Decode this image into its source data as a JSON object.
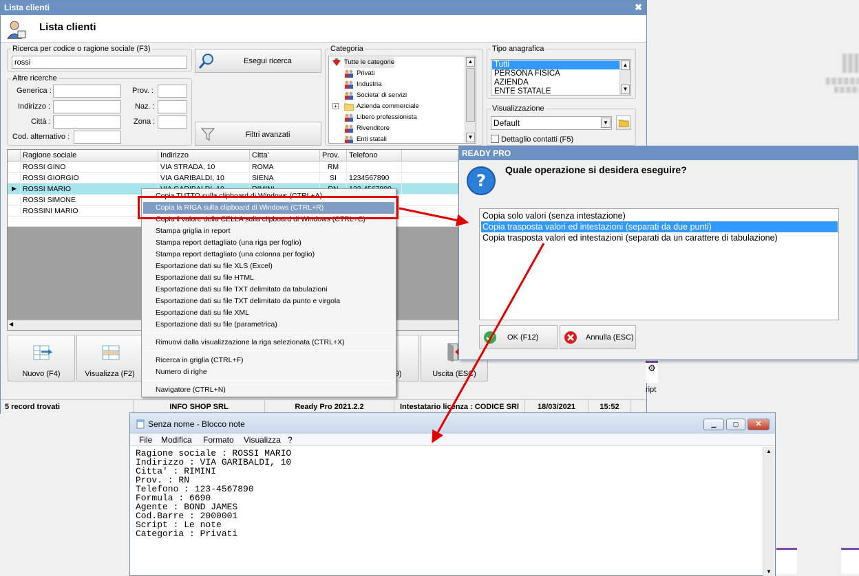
{
  "window": {
    "title": "Lista clienti",
    "header_title": "Lista clienti"
  },
  "search": {
    "group_label": "Ricerca per codice o ragione sociale (F3)",
    "value": "rossi",
    "execute_button": "Esegui ricerca",
    "advanced_filters_button": "Filtri avanzati"
  },
  "other_searches": {
    "group_label": "Altre ricerche",
    "generica_label": "Generica :",
    "indirizzo_label": "Indirizzo :",
    "citta_label": "Città :",
    "cod_alt_label": "Cod. alternativo :",
    "prov_label": "Prov. :",
    "naz_label": "Naz. :",
    "zona_label": "Zona :"
  },
  "categoria": {
    "group_label": "Categoria",
    "items": [
      "Tutte le categorie",
      "Privati",
      "Industria",
      "Societa' di servizi",
      "Azienda commerciale",
      "Libero professionista",
      "Rivenditore",
      "Enti statali"
    ]
  },
  "tipo_anagrafica": {
    "group_label": "Tipo anagrafica",
    "options": [
      "Tutti",
      "PERSONA FISICA",
      "AZIENDA",
      "ENTE STATALE"
    ],
    "selected": "Tutti"
  },
  "visualizzazione": {
    "group_label": "Visualizzazione",
    "selected": "Default",
    "checkbox_label": "Dettaglio contatti (F5)"
  },
  "grid": {
    "columns": [
      "Ragione sociale",
      "Indirizzo",
      "Citta'",
      "Prov.",
      "Telefono"
    ],
    "rows": [
      [
        "ROSSI GINO",
        "VIA STRADA, 10",
        "ROMA",
        "RM",
        ""
      ],
      [
        "ROSSI GIORGIO",
        "VIA GARIBALDI, 10",
        "SIENA",
        "SI",
        "1234567890"
      ],
      [
        "ROSSI MARIO",
        "VIA GARIBALDI, 10",
        "RIMINI",
        "RN",
        "123-4567890"
      ],
      [
        "ROSSI SIMONE",
        "",
        "",
        "",
        ""
      ],
      [
        "ROSSINI MARIO",
        "",
        "",
        "",
        ""
      ]
    ]
  },
  "buttons": {
    "nuovo": "Nuovo (F4)",
    "visualizza": "Visualizza (F2)",
    "hidden_f9": "F9)",
    "uscita": "Uscita (ESC)",
    "script": "ript"
  },
  "status": {
    "records": "5 record trovati",
    "company": "INFO SHOP SRL",
    "version": "Ready Pro 2021.2.2",
    "license": "Intestatario licenza : CODICE SRl",
    "date": "18/03/2021",
    "time": "15:52"
  },
  "context_menu": {
    "items": [
      "Copia TUTTO sulla clipboard di Windows (CTRL+A)",
      "Copia la RIGA sulla clipboard di Windows (CTRL+R)",
      "Copia il valore della CELLA sulla clipboard di Windows (CTRL+C)",
      "Stampa griglia in report",
      "Stampa report dettagliato (una riga per foglio)",
      "Stampa report dettagliato (una colonna per foglio)",
      "Esportazione dati su file XLS (Excel)",
      "Esportazione dati su file HTML",
      "Esportazione dati su file TXT delimitato da tabulazioni",
      "Esportazione dati su file TXT delimitato da punto e virgola",
      "Esportazione dati su file XML",
      "Esportazione dati su file (parametrica)",
      "Rimuovi dalla visualizzazione la riga selezionata (CTRL+X)",
      "Ricerca in griglia (CTRL+F)",
      "Numero di righe",
      "Navigatore (CTRL+N)"
    ]
  },
  "dialog": {
    "title": "READY PRO",
    "question": "Quale operazione si desidera eseguire?",
    "options": [
      "Copia solo valori (senza intestazione)",
      "Copia trasposta valori ed intestazioni (separati da due punti)",
      "Copia trasposta valori ed intestazioni (separati da un carattere di tabulazione)"
    ],
    "ok": "OK (F12)",
    "cancel": "Annulla (ESC)"
  },
  "notepad": {
    "title": "Senza nome - Blocco note",
    "menu": [
      "File",
      "Modifica",
      "Formato",
      "Visualizza",
      "?"
    ],
    "lines": [
      "Ragione sociale : ROSSI MARIO",
      "Indirizzo : VIA GARIBALDI, 10",
      "Citta' : RIMINI",
      "Prov. : RN",
      "Telefono : 123-4567890",
      "Formula : 6690",
      "Agente : BOND JAMES",
      "Cod.Barre : 2000001",
      "Script : Le note",
      "Categoria : Privati"
    ]
  },
  "colors": {
    "title_bar": "#6b92c2",
    "selection": "#3399ff",
    "highlight_row": "#a8e4ec",
    "annotation_red": "#e00000"
  }
}
